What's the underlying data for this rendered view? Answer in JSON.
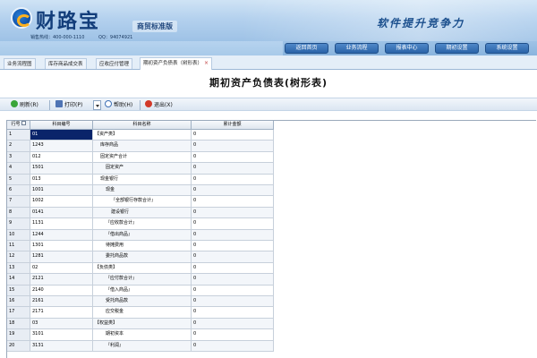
{
  "brand": {
    "name": "财路宝",
    "edition": "商贸标准版",
    "slogan": "软件提升竞争力",
    "hotline": "销售热线：400-000-1110",
    "qq": "QQ：94074921"
  },
  "topnav": [
    "返回首页",
    "业务流程",
    "报表中心",
    "期初设置",
    "系统设置"
  ],
  "tabs": [
    {
      "label": "业务流程图",
      "active": false
    },
    {
      "label": "库存商品成交表",
      "active": false
    },
    {
      "label": "应收应付管理",
      "active": false
    },
    {
      "label": "期初资产负债表（树形表）",
      "active": true
    }
  ],
  "page_title": "期初资产负债表(树形表)",
  "toolbar": {
    "refresh": "刷新(R)",
    "print": "打印(P)",
    "help": "帮助(H)",
    "exit": "退出(X)"
  },
  "table": {
    "columns": [
      "行号",
      "科目编号",
      "科目名称",
      "累计金额"
    ],
    "rows": [
      {
        "no": "1",
        "code": "01",
        "name": "【资产类】",
        "amount": "0",
        "indent": 0
      },
      {
        "no": "2",
        "code": "1243",
        "name": "库存商品",
        "amount": "0",
        "indent": 1
      },
      {
        "no": "3",
        "code": "012",
        "name": "固定资产合计",
        "amount": "0",
        "indent": 1
      },
      {
        "no": "4",
        "code": "1501",
        "name": "固定资产",
        "amount": "0",
        "indent": 2
      },
      {
        "no": "5",
        "code": "013",
        "name": "现金银行",
        "amount": "0",
        "indent": 1
      },
      {
        "no": "6",
        "code": "1001",
        "name": "现金",
        "amount": "0",
        "indent": 2
      },
      {
        "no": "7",
        "code": "1002",
        "name": "『全部银行存款合计』",
        "amount": "0",
        "indent": 3
      },
      {
        "no": "8",
        "code": "0141",
        "name": "建设银行",
        "amount": "0",
        "indent": 3
      },
      {
        "no": "9",
        "code": "1131",
        "name": "『应收款合计』",
        "amount": "0",
        "indent": 2
      },
      {
        "no": "10",
        "code": "1244",
        "name": "『借出商品』",
        "amount": "0",
        "indent": 2
      },
      {
        "no": "11",
        "code": "1301",
        "name": "待摊费用",
        "amount": "0",
        "indent": 2
      },
      {
        "no": "12",
        "code": "1281",
        "name": "委托商品款",
        "amount": "0",
        "indent": 2
      },
      {
        "no": "13",
        "code": "02",
        "name": "【负债类】",
        "amount": "0",
        "indent": 0
      },
      {
        "no": "14",
        "code": "2121",
        "name": "『应付款合计』",
        "amount": "0",
        "indent": 2
      },
      {
        "no": "15",
        "code": "2140",
        "name": "『借入商品』",
        "amount": "0",
        "indent": 2
      },
      {
        "no": "16",
        "code": "2161",
        "name": "受托商品款",
        "amount": "0",
        "indent": 2
      },
      {
        "no": "17",
        "code": "2171",
        "name": "应交税金",
        "amount": "0",
        "indent": 2
      },
      {
        "no": "18",
        "code": "03",
        "name": "【权益类】",
        "amount": "0",
        "indent": 0
      },
      {
        "no": "19",
        "code": "3101",
        "name": "期初资本",
        "amount": "0",
        "indent": 2
      },
      {
        "no": "20",
        "code": "3131",
        "name": "『利润』",
        "amount": "0",
        "indent": 2
      }
    ]
  }
}
